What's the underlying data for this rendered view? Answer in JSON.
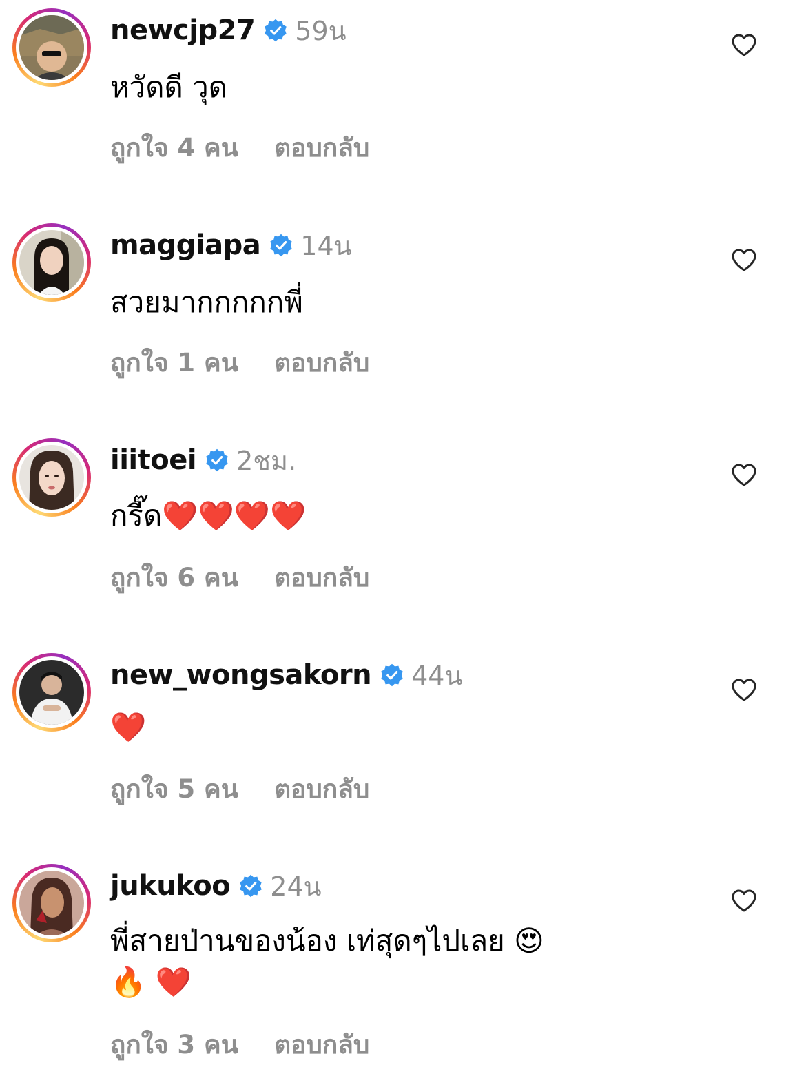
{
  "comments": [
    {
      "username": "newcjp27",
      "time": "59น",
      "text": "หวัดดี วุด",
      "likes": "ถูกใจ 4 คน",
      "reply": "ตอบกลับ"
    },
    {
      "username": "maggiapa",
      "time": "14น",
      "text": "สวยมากกกกกพี่",
      "likes": "ถูกใจ 1 คน",
      "reply": "ตอบกลับ"
    },
    {
      "username": "iiitoei",
      "time": "2ชม.",
      "text": "กรี๊ด❤️❤️❤️❤️",
      "likes": "ถูกใจ 6 คน",
      "reply": "ตอบกลับ"
    },
    {
      "username": "new_wongsakorn",
      "time": "44น",
      "text": "❤️",
      "likes": "ถูกใจ 5 คน",
      "reply": "ตอบกลับ"
    },
    {
      "username": "jukukoo",
      "time": "24น",
      "text": "พี่สายป่านของน้อง เท่สุดๆไปเลย 😍\n🔥 ❤️",
      "likes": "ถูกใจ 3 คน",
      "reply": "ตอบกลับ"
    }
  ],
  "icons": {
    "verified": "verified-badge-icon",
    "like": "heart-outline-icon"
  },
  "colors": {
    "verified": "#3797f0",
    "secondary_text": "#8e8e8e",
    "story_ring_start": "#feda75",
    "story_ring_end": "#d62976"
  }
}
